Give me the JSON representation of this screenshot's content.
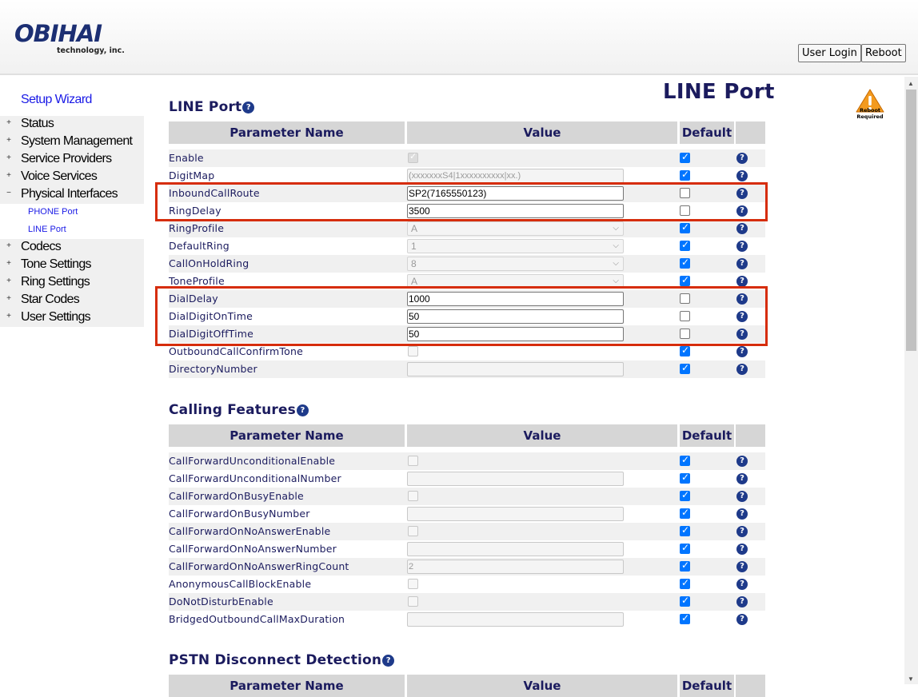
{
  "header": {
    "logo": "OBIHAI",
    "logo_sub": "technology, inc.",
    "user_login": "User Login",
    "reboot": "Reboot"
  },
  "sidebar": {
    "setup_wizard": "Setup Wizard",
    "items": [
      {
        "sign": "+",
        "label": "Status"
      },
      {
        "sign": "+",
        "label": "System Management"
      },
      {
        "sign": "+",
        "label": "Service Providers"
      },
      {
        "sign": "+",
        "label": "Voice Services"
      },
      {
        "sign": "−",
        "label": "Physical Interfaces"
      },
      {
        "sign": "+",
        "label": "Codecs"
      },
      {
        "sign": "+",
        "label": "Tone Settings"
      },
      {
        "sign": "+",
        "label": "Ring Settings"
      },
      {
        "sign": "+",
        "label": "Star Codes"
      },
      {
        "sign": "+",
        "label": "User Settings"
      }
    ],
    "sub_items": [
      "PHONE Port",
      "LINE Port"
    ]
  },
  "page_title": "LINE Port",
  "reboot_required": {
    "line1": "Reboot",
    "line2": "Required"
  },
  "table_headers": {
    "param": "Parameter Name",
    "value": "Value",
    "default": "Default"
  },
  "help_glyph": "?",
  "sections": {
    "line_port": {
      "title": "LINE Port",
      "rows": [
        {
          "name": "Enable",
          "type": "checkbox",
          "value": true,
          "disabled": true,
          "default": true
        },
        {
          "name": "DigitMap",
          "type": "text",
          "value": "(xxxxxxxS4|1xxxxxxxxxx|xx.)",
          "disabled": true,
          "default": true
        },
        {
          "name": "InboundCallRoute",
          "type": "text",
          "value": "SP2(7165550123)",
          "disabled": false,
          "default": false
        },
        {
          "name": "RingDelay",
          "type": "text",
          "value": "3500",
          "disabled": false,
          "default": false
        },
        {
          "name": "RingProfile",
          "type": "select",
          "value": "A",
          "disabled": true,
          "default": true
        },
        {
          "name": "DefaultRing",
          "type": "select",
          "value": "1",
          "disabled": true,
          "default": true
        },
        {
          "name": "CallOnHoldRing",
          "type": "select",
          "value": "8",
          "disabled": true,
          "default": true
        },
        {
          "name": "ToneProfile",
          "type": "select",
          "value": "A",
          "disabled": true,
          "default": true
        },
        {
          "name": "DialDelay",
          "type": "text",
          "value": "1000",
          "disabled": false,
          "default": false
        },
        {
          "name": "DialDigitOnTime",
          "type": "text",
          "value": "50",
          "disabled": false,
          "default": false
        },
        {
          "name": "DialDigitOffTime",
          "type": "text",
          "value": "50",
          "disabled": false,
          "default": false
        },
        {
          "name": "OutboundCallConfirmTone",
          "type": "checkbox",
          "value": false,
          "disabled": true,
          "default": true
        },
        {
          "name": "DirectoryNumber",
          "type": "text",
          "value": "",
          "disabled": true,
          "default": true
        }
      ]
    },
    "calling_features": {
      "title": "Calling Features",
      "rows": [
        {
          "name": "CallForwardUnconditionalEnable",
          "type": "checkbox",
          "value": false,
          "disabled": true,
          "default": true
        },
        {
          "name": "CallForwardUnconditionalNumber",
          "type": "text",
          "value": "",
          "disabled": true,
          "default": true
        },
        {
          "name": "CallForwardOnBusyEnable",
          "type": "checkbox",
          "value": false,
          "disabled": true,
          "default": true
        },
        {
          "name": "CallForwardOnBusyNumber",
          "type": "text",
          "value": "",
          "disabled": true,
          "default": true
        },
        {
          "name": "CallForwardOnNoAnswerEnable",
          "type": "checkbox",
          "value": false,
          "disabled": true,
          "default": true
        },
        {
          "name": "CallForwardOnNoAnswerNumber",
          "type": "text",
          "value": "",
          "disabled": true,
          "default": true
        },
        {
          "name": "CallForwardOnNoAnswerRingCount",
          "type": "text",
          "value": "2",
          "disabled": true,
          "default": true
        },
        {
          "name": "AnonymousCallBlockEnable",
          "type": "checkbox",
          "value": false,
          "disabled": true,
          "default": true
        },
        {
          "name": "DoNotDisturbEnable",
          "type": "checkbox",
          "value": false,
          "disabled": true,
          "default": true
        },
        {
          "name": "BridgedOutboundCallMaxDuration",
          "type": "text",
          "value": "",
          "disabled": true,
          "default": true
        }
      ]
    },
    "pstn": {
      "title": "PSTN Disconnect Detection"
    }
  },
  "colors": {
    "accent_blue": "#1b1b5e",
    "link_blue": "#1a1ae6",
    "highlight_red": "#d62d0c",
    "checkbox_blue": "#0075ff"
  }
}
